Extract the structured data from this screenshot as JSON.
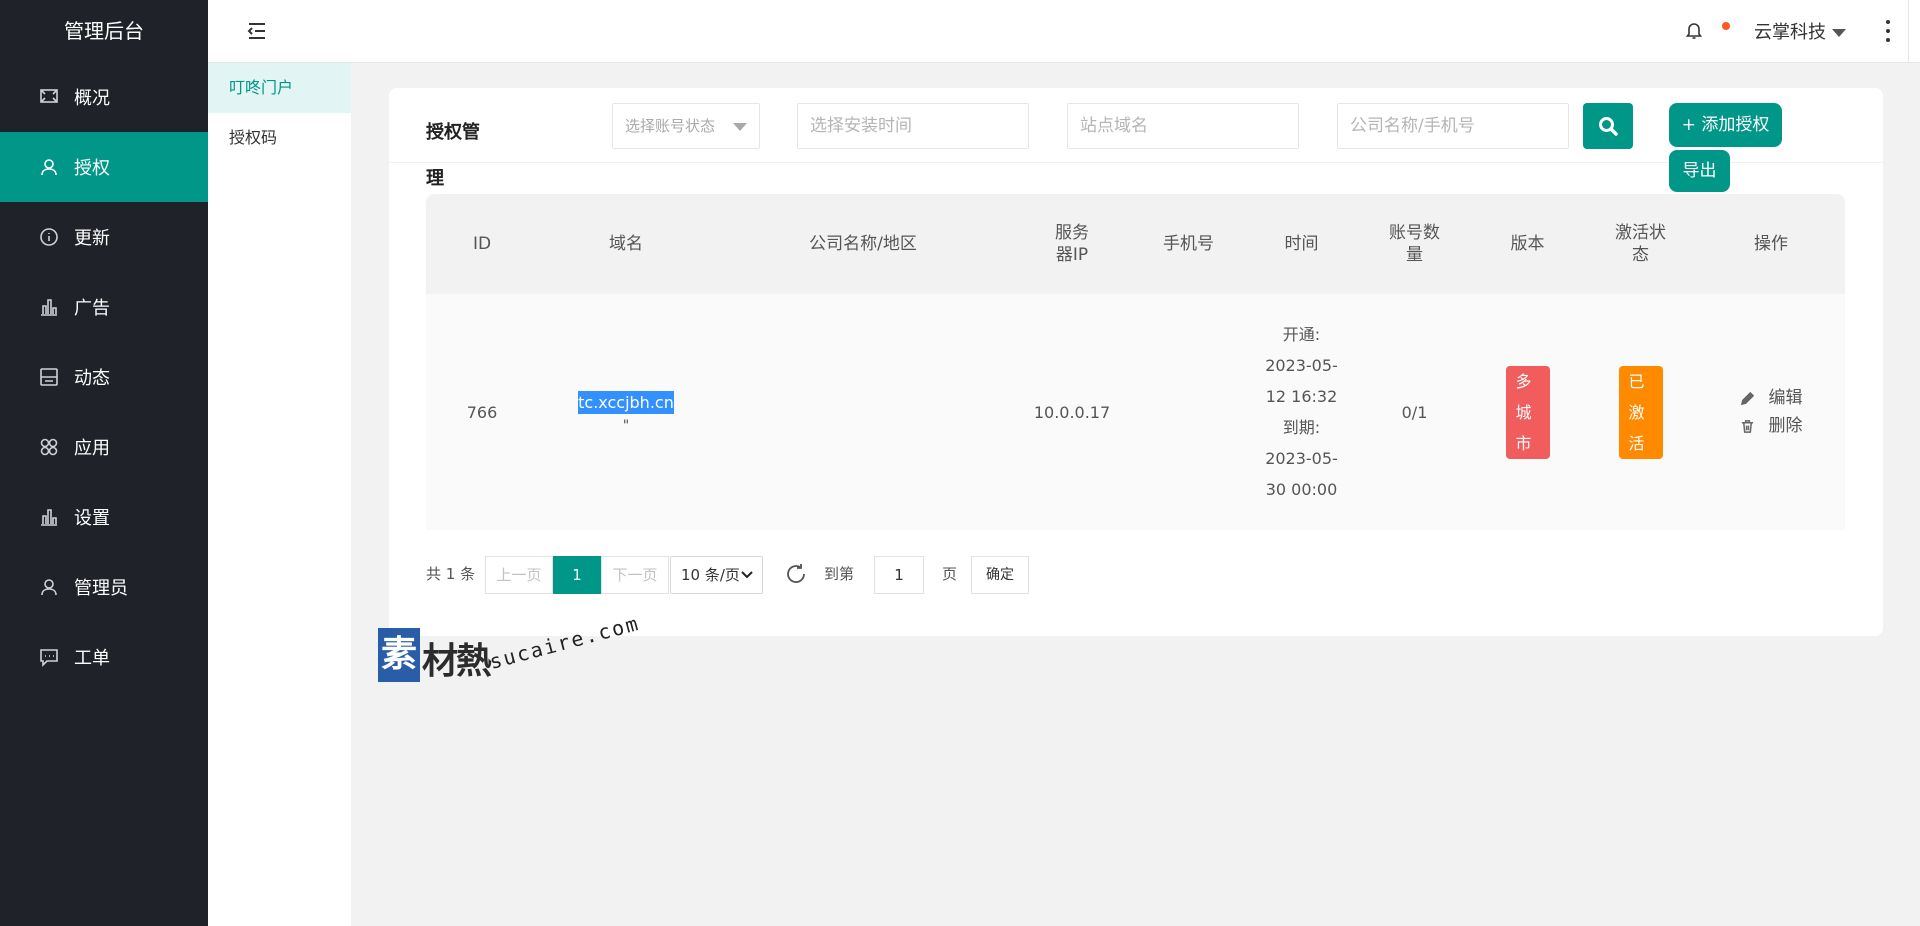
{
  "sidebar": {
    "brand": "管理后台",
    "items": [
      {
        "label": "概况",
        "icon": "monitor-icon"
      },
      {
        "label": "授权",
        "icon": "user-icon"
      },
      {
        "label": "更新",
        "icon": "info-icon"
      },
      {
        "label": "广告",
        "icon": "bar-chart-icon"
      },
      {
        "label": "动态",
        "icon": "layout-icon"
      },
      {
        "label": "应用",
        "icon": "apps-icon"
      },
      {
        "label": "设置",
        "icon": "bar-chart-icon"
      },
      {
        "label": "管理员",
        "icon": "user-icon"
      },
      {
        "label": "工单",
        "icon": "message-icon"
      }
    ],
    "active_index": 1
  },
  "header": {
    "user_name": "云掌科技"
  },
  "submenu": {
    "items": [
      "叮咚门户",
      "授权码"
    ],
    "active_index": 0
  },
  "page": {
    "title": "授权管理",
    "filters": {
      "status_placeholder": "选择账号状态",
      "time_placeholder": "选择安装时间",
      "domain_placeholder": "站点域名",
      "company_placeholder": "公司名称/手机号"
    },
    "add_button": "+ 添加授权",
    "export_button": "导出"
  },
  "table": {
    "columns": [
      "ID",
      "域名",
      "公司名称/地区",
      "服务器IP",
      "手机号",
      "时间",
      "账号数量",
      "版本",
      "激活状态",
      "操作"
    ],
    "rows": [
      {
        "id": "766",
        "domain": "tc.xccjbh.cn",
        "domain_extra": "\"",
        "company": "",
        "server_ip": "10.0.0.17",
        "phone": "",
        "open_label": "开通:",
        "open_date": "2023-05-",
        "open_time": "12 16:32",
        "expire_label": "到期:",
        "expire_date": "2023-05-",
        "expire_time": "30 00:00",
        "accounts": "0/1",
        "version": "多城市",
        "status": "已激活",
        "edit": "编辑",
        "delete": "删除"
      }
    ]
  },
  "pagination": {
    "total": "共 1 条",
    "prev": "上一页",
    "current": "1",
    "next": "下一页",
    "page_size": "10 条/页",
    "goto_label": "到第",
    "goto_value": "1",
    "page_unit": "页",
    "confirm": "确定"
  },
  "watermark": {
    "box_char": "素",
    "text": "材熱",
    "url": "sucaire.com"
  },
  "colors": {
    "sidebar_bg": "#20222a",
    "accent": "#009688",
    "badge_red": "#f15d5d",
    "badge_orange": "#ff8a00",
    "notify_dot": "#ff5722"
  }
}
